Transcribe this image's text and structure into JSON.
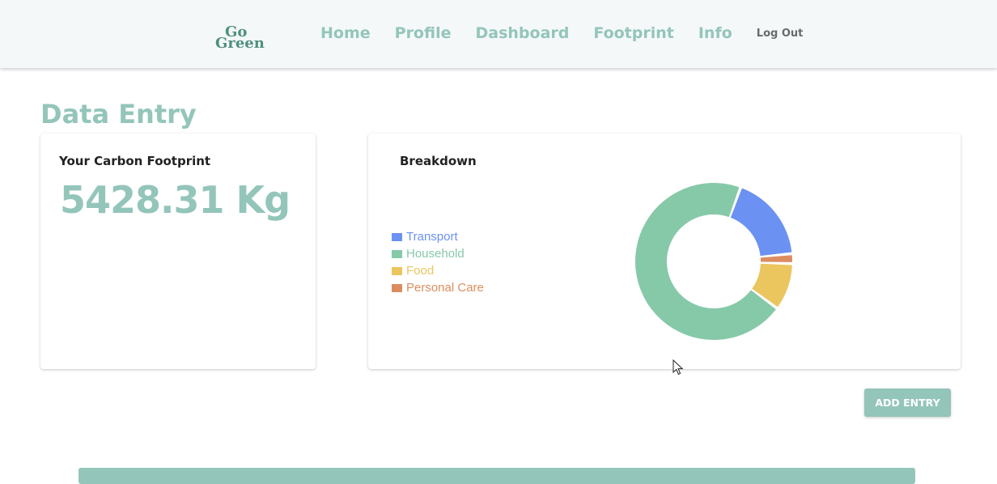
{
  "header": {
    "logo": {
      "line1": "Go",
      "line2": "Green"
    },
    "nav": [
      "Home",
      "Profile",
      "Dashboard",
      "Footprint",
      "Info"
    ],
    "logout_label": "Log Out",
    "accent_color": "#94c5ba"
  },
  "page": {
    "title": "Data Entry"
  },
  "footprint_card": {
    "title": "Your Carbon Footprint",
    "value": "5428.31 Kg"
  },
  "breakdown_card": {
    "title": "Breakdown"
  },
  "chart_data": {
    "type": "pie",
    "title": "Breakdown",
    "categories": [
      "Transport",
      "Household",
      "Food",
      "Personal Care"
    ],
    "values": [
      17.5,
      69,
      9.5,
      2
    ],
    "colors": [
      "#6b91f2",
      "#86c9a9",
      "#ebc65f",
      "#db8d60"
    ],
    "donut": true,
    "legend": "left"
  },
  "actions": {
    "add_entry_label": "ADD ENTRY"
  },
  "icons": {
    "cursor": "arrow-cursor-icon"
  }
}
